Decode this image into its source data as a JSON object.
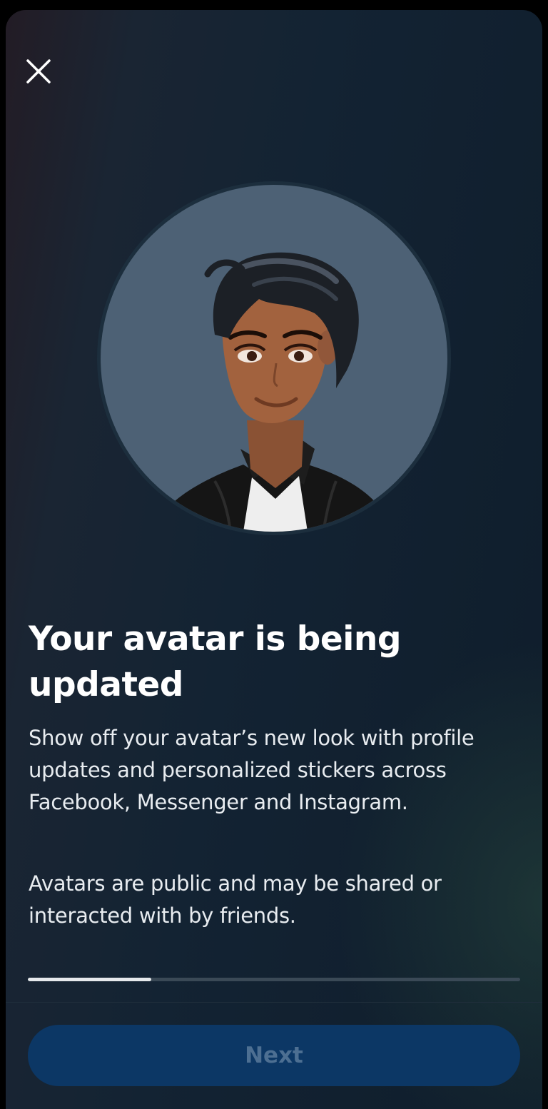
{
  "dialog": {
    "close_icon": "close-icon"
  },
  "avatar": {
    "image_icon": "avatar-illustration"
  },
  "content": {
    "title": "Your avatar is being updated",
    "paragraph_1": "Show off your avatar’s new look with profile updates and personalized stickers across Facebook, Messenger and Instagram.",
    "paragraph_2": "Avatars are public and may be shared or interacted with by friends."
  },
  "progress": {
    "value": 0.25
  },
  "footer": {
    "next_label": "Next",
    "next_enabled": false
  },
  "colors": {
    "background": "#132333",
    "avatar_circle": "#4d6175",
    "button_disabled": "#0c3765",
    "button_text_disabled": "#4d6f92"
  }
}
